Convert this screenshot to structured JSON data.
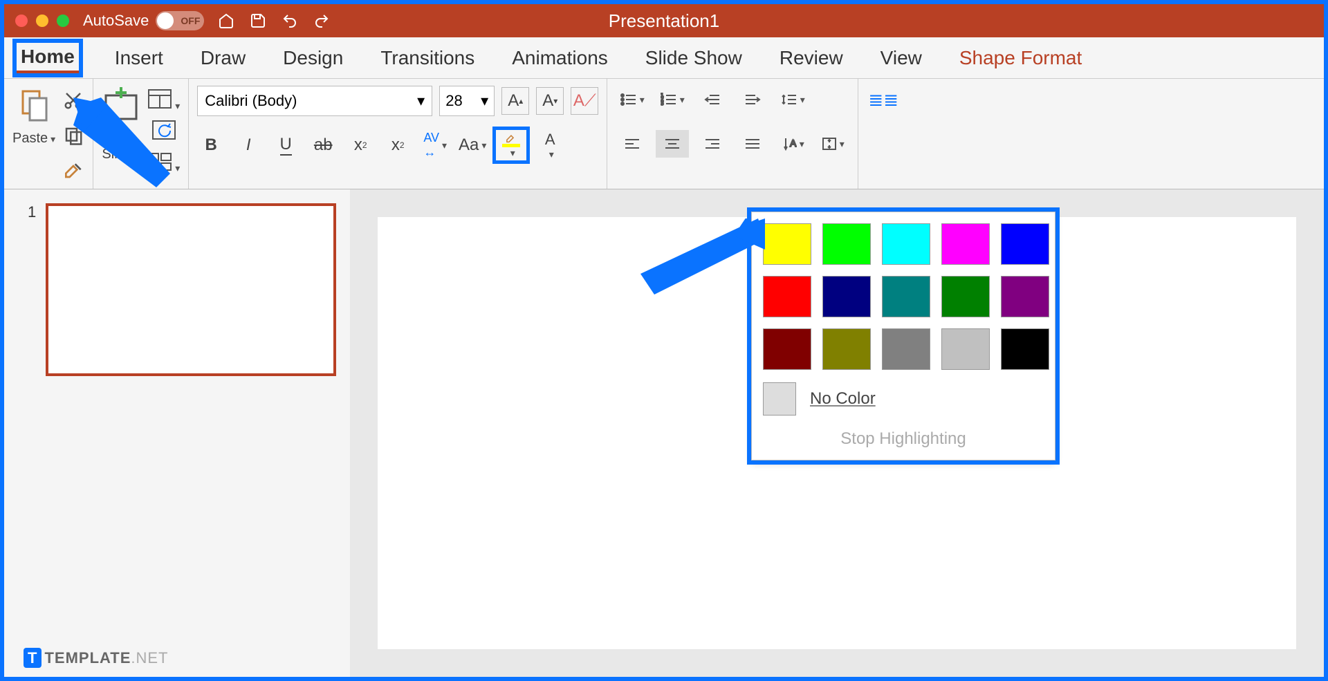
{
  "titlebar": {
    "autosave_label": "AutoSave",
    "autosave_state": "OFF",
    "doc_title": "Presentation1"
  },
  "tabs": [
    "Home",
    "Insert",
    "Draw",
    "Design",
    "Transitions",
    "Animations",
    "Slide Show",
    "Review",
    "View",
    "Shape Format"
  ],
  "ribbon": {
    "paste": "Paste",
    "new_slide": "New\nSlide",
    "font_name": "Calibri (Body)",
    "font_size": "28"
  },
  "thumbs": {
    "num": "1"
  },
  "highlight_popup": {
    "colors_row1": [
      "#ffff00",
      "#00ff00",
      "#00ffff",
      "#ff00ff",
      "#0000ff"
    ],
    "colors_row2": [
      "#ff0000",
      "#000080",
      "#008080",
      "#008000",
      "#800080"
    ],
    "colors_row3": [
      "#800000",
      "#808000",
      "#808080",
      "#c0c0c0",
      "#000000"
    ],
    "no_color": "No Color",
    "stop": "Stop Highlighting"
  },
  "watermark": {
    "brand": "TEMPLATE",
    "suffix": ".NET"
  }
}
